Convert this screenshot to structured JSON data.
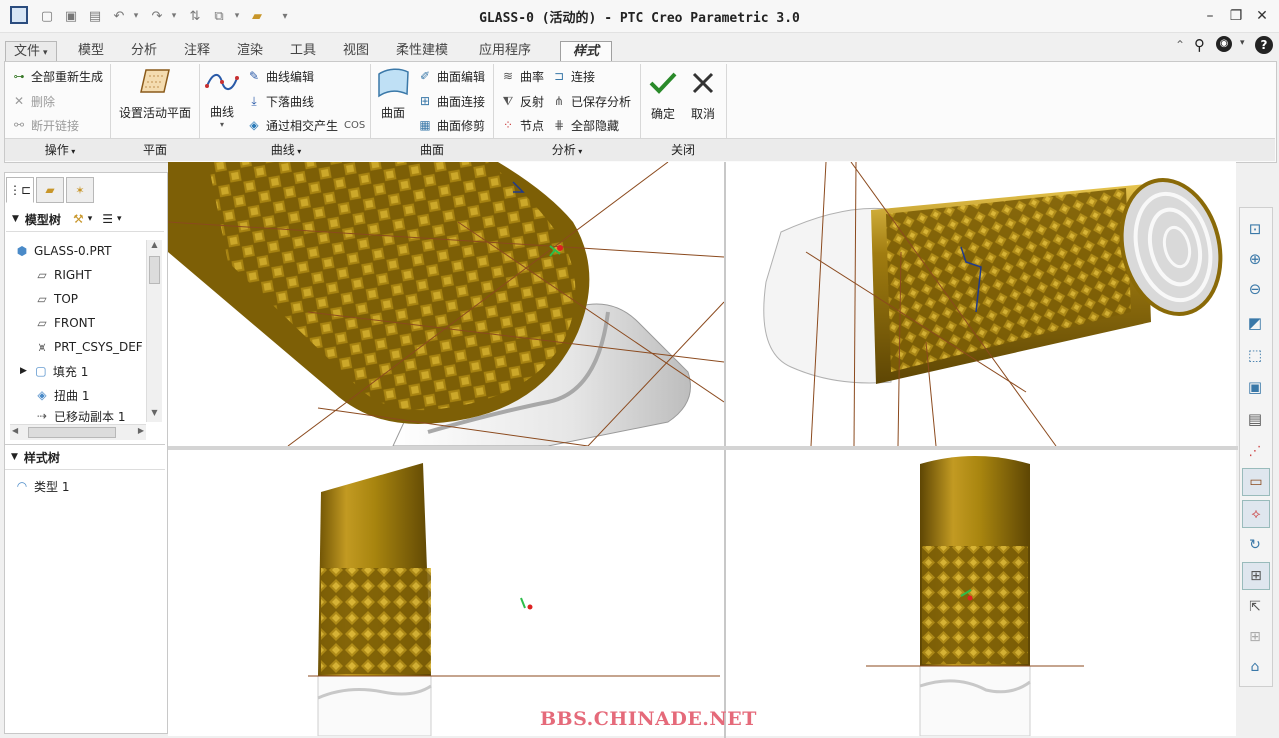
{
  "window": {
    "title": "GLASS-0 (活动的) - PTC Creo Parametric 3.0"
  },
  "tabs": {
    "file": "文件",
    "items": [
      "模型",
      "分析",
      "注释",
      "渲染",
      "工具",
      "视图",
      "柔性建模",
      "应用程序"
    ],
    "active": "样式"
  },
  "ribbon": {
    "operations": {
      "regen_all": "全部重新生成",
      "delete": "删除",
      "break_link": "断开链接",
      "group": "操作"
    },
    "plane": {
      "set_active_plane": "设置活动平面",
      "group": "平面"
    },
    "curve": {
      "curve": "曲线",
      "curve_edit": "曲线编辑",
      "drop_curve": "下落曲线",
      "cos": "通过相交产生",
      "cos_tag": "COS",
      "group": "曲线"
    },
    "surface": {
      "surface": "曲面",
      "surface_edit": "曲面编辑",
      "surface_connect": "曲面连接",
      "surface_trim": "曲面修剪",
      "group": "曲面"
    },
    "analysis": {
      "curvature": "曲率",
      "connect": "连接",
      "reflection": "反射",
      "saved_analysis": "已保存分析",
      "node": "节点",
      "hide_all": "全部隐藏",
      "group": "分析"
    },
    "close": {
      "ok": "确定",
      "cancel": "取消",
      "group": "关闭"
    }
  },
  "model_tree": {
    "header": "模型树",
    "items": [
      "GLASS-0.PRT",
      "RIGHT",
      "TOP",
      "FRONT",
      "PRT_CSYS_DEF",
      "填充 1",
      "扭曲 1",
      "已移动副本 1"
    ]
  },
  "style_tree": {
    "header": "样式树",
    "items": [
      "类型 1"
    ]
  },
  "watermark": "BBS.CHINADE.NET",
  "colors": {
    "gold": "#8a6a08",
    "datum_plane": "#8b4a1e",
    "viewport_bg": "#ffffff",
    "watermark": "#e56a7a"
  }
}
